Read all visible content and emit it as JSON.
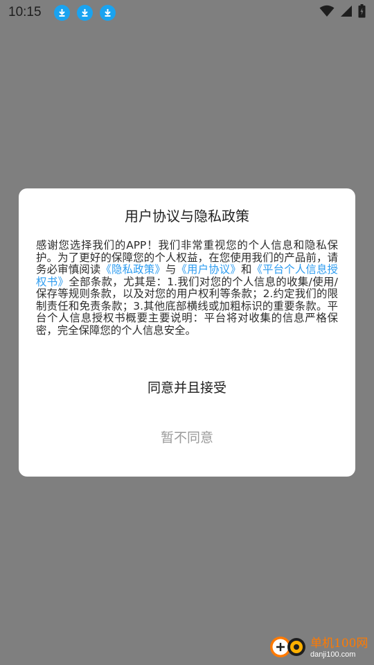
{
  "status_bar": {
    "time": "10:15",
    "notification_icons": [
      "download-icon",
      "download-icon",
      "download-icon"
    ],
    "system_icons": [
      "wifi-icon",
      "signal-icon",
      "battery-icon"
    ]
  },
  "dialog": {
    "title": "用户协议与隐私政策",
    "body": {
      "part1": "感谢您选择我们的APP！我们非常重视您的个人信息和隐私保护。为了更好的保障您的个人权益，在您使用我们的产品前，请务必审慎阅读",
      "link_privacy": "《隐私政策》",
      "connector_and1": "与",
      "link_agreement": "《用户协议》",
      "connector_and2": "和",
      "link_authorization": "《平台个人信息授权书》",
      "part2": "全部条款，尤其是：1.我们对您的个人信息的收集/使用/保存等规则条款，以及对您的用户权利等条款；2.约定我们的限制责任和免责条款；3.其他底部横线或加粗标识的重要条款。平台个人信息授权书概要主要说明：平台将对收集的信息严格保密，完全保障您的个人信息安全。"
    },
    "agree_button": "同意并且接受",
    "decline_button": "暂不同意"
  },
  "watermark": {
    "name": "单机100网",
    "url": "danji100.com"
  },
  "colors": {
    "overlay": "#7f7f7f",
    "link": "#2d9cf0",
    "download_icon": "#1aa3f0",
    "decline_text": "#9a9a9a"
  }
}
